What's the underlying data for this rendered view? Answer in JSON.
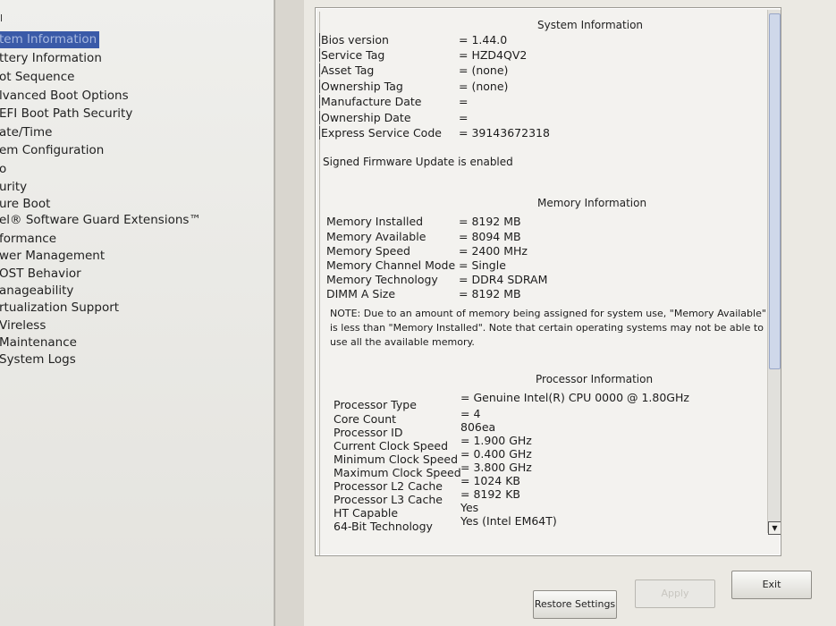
{
  "nav": {
    "top_glyph": "l",
    "items": [
      {
        "label": "tem Information",
        "selected": true
      },
      {
        "label": "ttery Information"
      },
      {
        "label": "ot Sequence"
      },
      {
        "label": "lvanced Boot Options"
      },
      {
        "label": "EFI Boot Path Security"
      },
      {
        "label": "ate/Time"
      },
      {
        "label": "em Configuration"
      },
      {
        "label": "o"
      },
      {
        "label": "urity"
      },
      {
        "label": "ure Boot"
      },
      {
        "label": "el® Software Guard Extensions™"
      },
      {
        "label": "formance"
      },
      {
        "label": "wer Management"
      },
      {
        "label": "OST Behavior"
      },
      {
        "label": "anageability"
      },
      {
        "label": "rtualization Support"
      },
      {
        "label": "Vireless"
      },
      {
        "label": "Maintenance"
      },
      {
        "label": "System Logs"
      }
    ]
  },
  "system": {
    "title": "System Information",
    "rows": [
      {
        "label": "Bios version",
        "value": "1.44.0"
      },
      {
        "label": "Service Tag",
        "value": "HZD4QV2"
      },
      {
        "label": "Asset Tag",
        "value": "(none)"
      },
      {
        "label": "Ownership Tag",
        "value": "(none)"
      },
      {
        "label": "Manufacture Date",
        "value": ""
      },
      {
        "label": "Ownership Date",
        "value": ""
      },
      {
        "label": "Express Service Code",
        "value": "39143672318"
      }
    ],
    "firmware_msg": "Signed Firmware Update is enabled"
  },
  "memory": {
    "title": "Memory Information",
    "rows": [
      {
        "label": "Memory Installed",
        "value": "8192 MB"
      },
      {
        "label": "Memory Available",
        "value": "8094 MB"
      },
      {
        "label": "Memory Speed",
        "value": "2400 MHz"
      },
      {
        "label": "Memory Channel Mode",
        "value": "Single"
      },
      {
        "label": "Memory Technology",
        "value": "DDR4 SDRAM"
      },
      {
        "label": "DIMM A Size",
        "value": "8192 MB"
      }
    ],
    "note": "NOTE: Due to an amount of memory being assigned for system use, \"Memory Available\" is less than \"Memory Installed\". Note that certain operating systems may not be able to use all the available memory."
  },
  "processor": {
    "title": "Processor Information",
    "rows": [
      {
        "label": "Processor Type",
        "value": "Genuine Intel(R) CPU 0000 @ 1.80GHz"
      },
      {
        "label": "Core Count",
        "value": "4"
      },
      {
        "label": "Processor ID",
        "value": "806ea"
      },
      {
        "label": "Current Clock Speed",
        "value": "1.900 GHz"
      },
      {
        "label": "Minimum Clock Speed",
        "value": "0.400 GHz"
      },
      {
        "label": "Maximum Clock Speed",
        "value": "3.800 GHz"
      },
      {
        "label": "Processor L2 Cache",
        "value": "1024 KB"
      },
      {
        "label": "Processor L3 Cache",
        "value": "8192 KB"
      },
      {
        "label": "HT Capable",
        "value": "Yes"
      },
      {
        "label": "64-Bit Technology",
        "value": "Yes (Intel EM64T)"
      }
    ]
  },
  "buttons": {
    "restore": "Restore Settings",
    "apply": "Apply",
    "exit": "Exit"
  },
  "colors": {
    "selection": "#3a5aa8",
    "pane_bg": "#f3f2ef"
  }
}
